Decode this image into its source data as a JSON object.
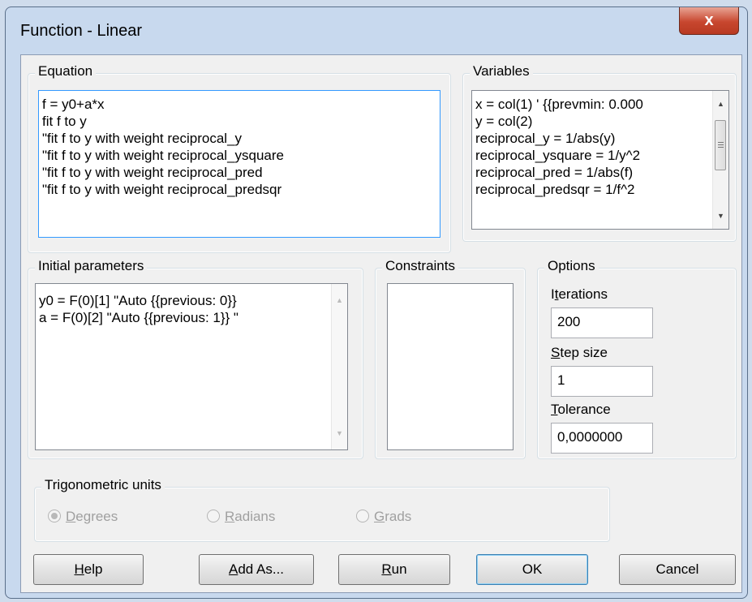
{
  "window": {
    "title": "Function - Linear",
    "close_label": "x"
  },
  "equation": {
    "label": "Equation",
    "lines": [
      "f = y0+a*x",
      "fit f to y",
      "\"fit f to y with weight reciprocal_y",
      "\"fit f to y with weight reciprocal_ysquare",
      "\"fit f to y with weight reciprocal_pred",
      "\"fit f to y with weight reciprocal_predsqr"
    ]
  },
  "variables": {
    "label": "Variables",
    "lines": [
      "x = col(1) ' {{prevmin: 0.000",
      "y = col(2)",
      "reciprocal_y = 1/abs(y)",
      "reciprocal_ysquare = 1/y^2",
      "reciprocal_pred = 1/abs(f)",
      "reciprocal_predsqr = 1/f^2"
    ]
  },
  "initial_parameters": {
    "label": "Initial parameters",
    "lines": [
      "y0 = F(0)[1] \"Auto {{previous: 0}}",
      "a = F(0)[2] \"Auto {{previous: 1}} \""
    ]
  },
  "constraints": {
    "label": "Constraints"
  },
  "options": {
    "label": "Options",
    "iterations": {
      "label_pre": "I",
      "label_ul": "t",
      "label_post": "erations",
      "value": "200"
    },
    "step_size": {
      "label_pre": "",
      "label_ul": "S",
      "label_post": "tep size",
      "value": "1"
    },
    "tolerance": {
      "label_pre": "",
      "label_ul": "T",
      "label_post": "olerance",
      "value": "0,0000000"
    }
  },
  "trig_units": {
    "label": "Trigonometric units",
    "degrees": {
      "ul": "D",
      "rest": "egrees",
      "selected": true
    },
    "radians": {
      "ul": "R",
      "rest": "adians",
      "selected": false
    },
    "grads": {
      "ul": "G",
      "rest": "rads",
      "selected": false
    }
  },
  "buttons": {
    "help": {
      "ul": "H",
      "rest": "elp"
    },
    "add_as": {
      "ul": "A",
      "rest": "dd As..."
    },
    "run": {
      "ul": "R",
      "rest": "un"
    },
    "ok": {
      "label": "OK"
    },
    "cancel": {
      "label": "Cancel"
    }
  },
  "colors": {
    "focus_border": "#3399ff",
    "close_button": "#c8462e",
    "title_bar": "#c8d9ee"
  }
}
